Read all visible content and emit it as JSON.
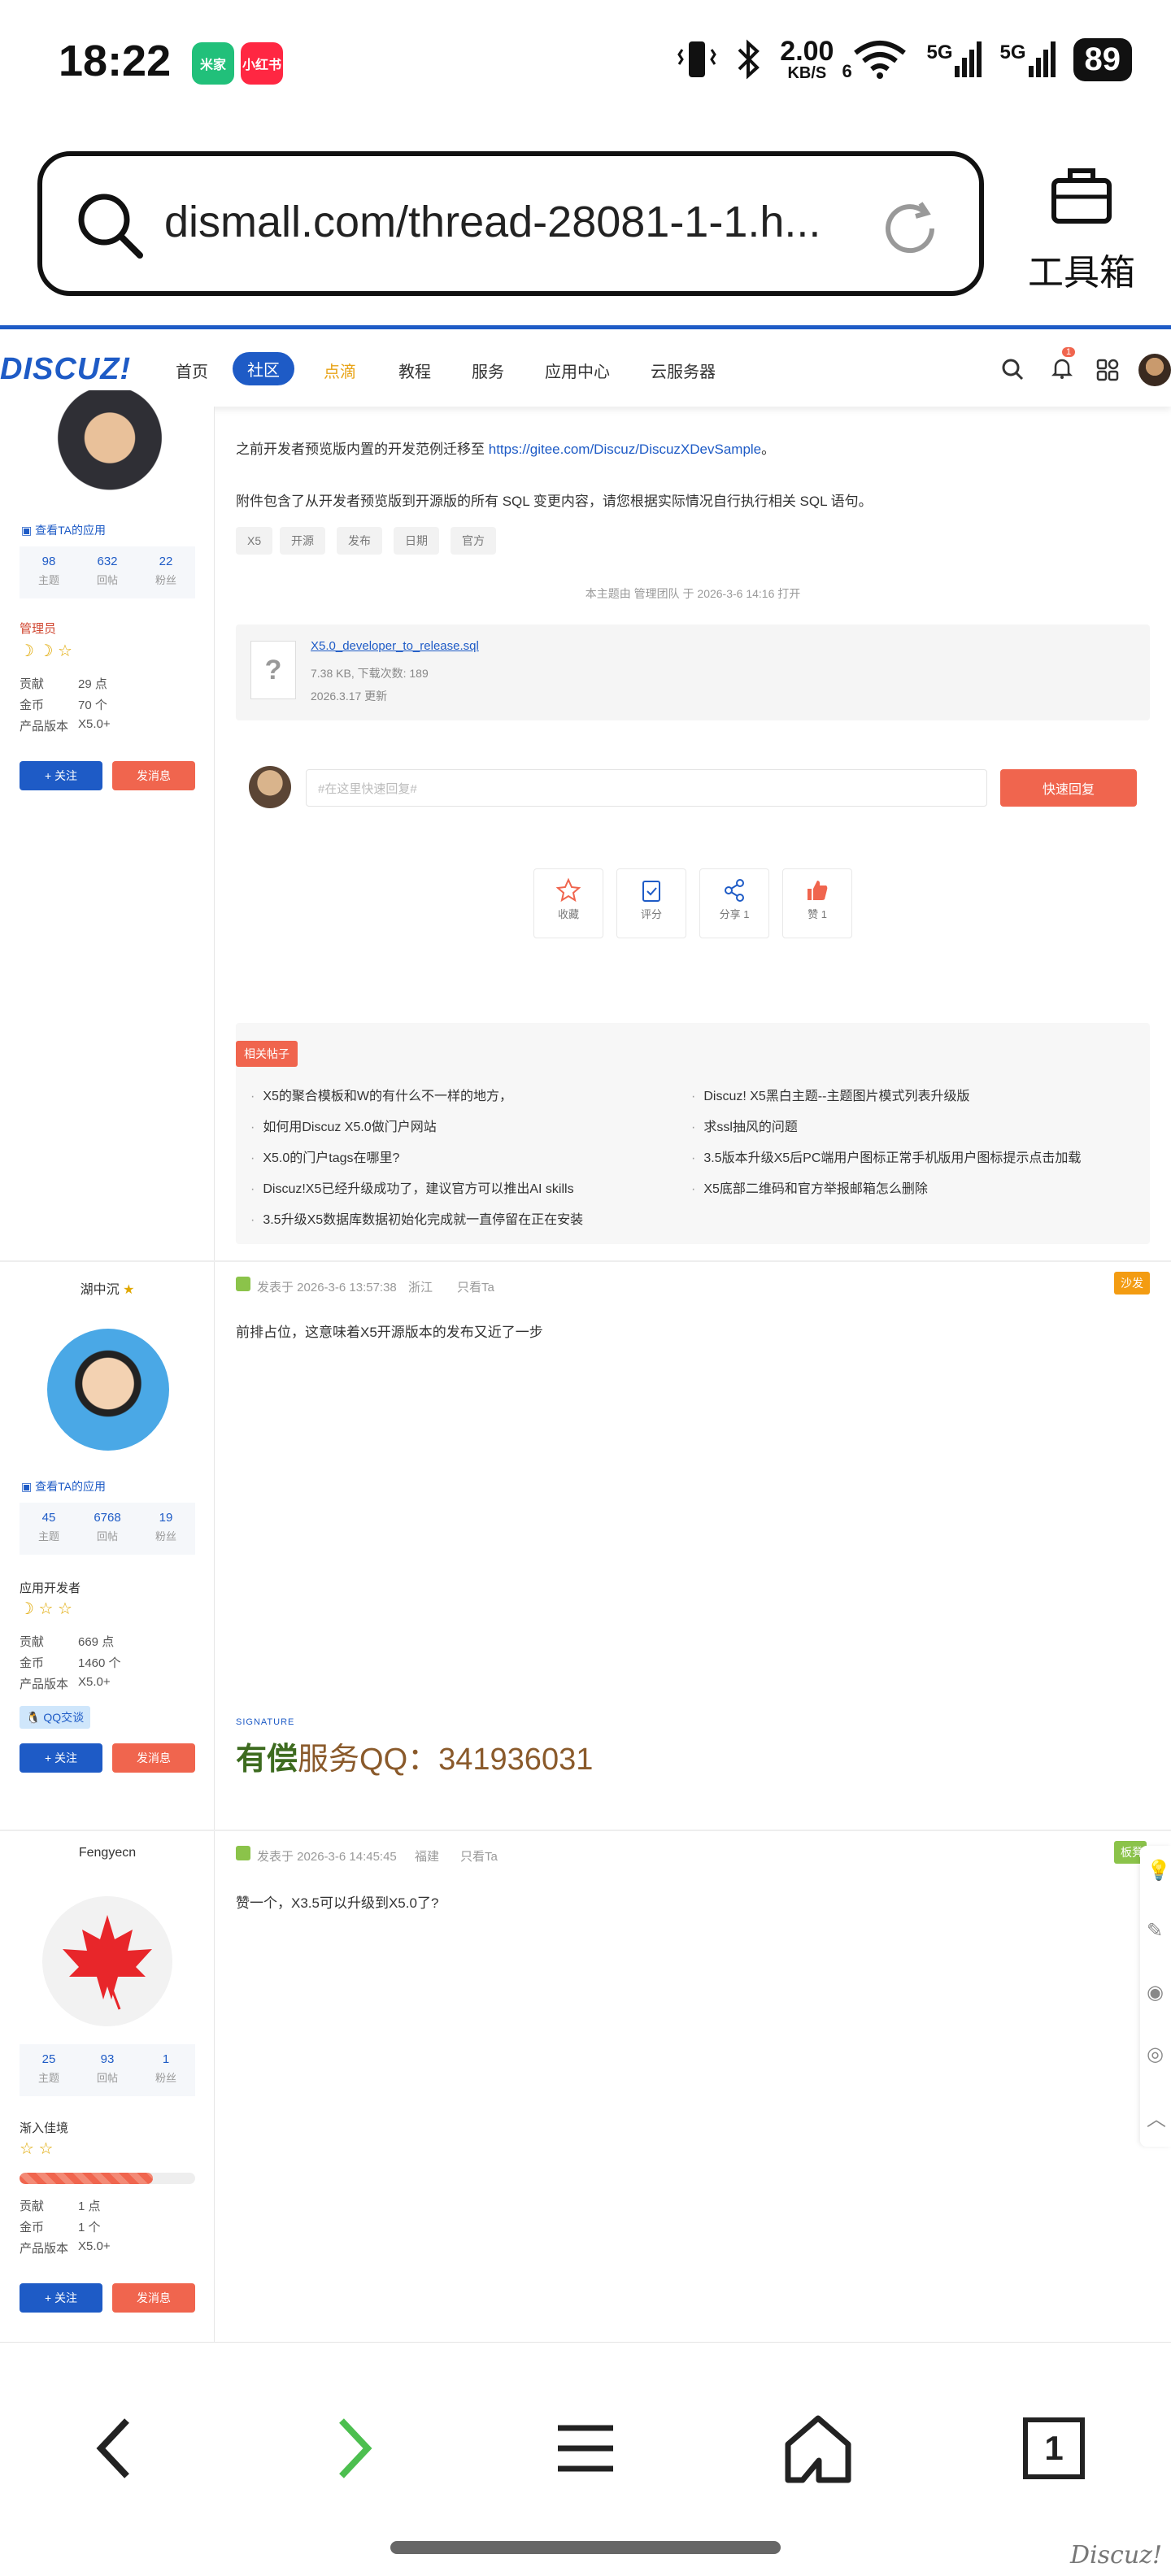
{
  "status_bar": {
    "time": "18:22",
    "apps": [
      "米家",
      "小红书"
    ],
    "network_speed_value": "2.00",
    "network_speed_unit": "KB/S",
    "wifi_label": "6",
    "signal_1": "5G",
    "signal_2": "5G",
    "battery": "89"
  },
  "browser": {
    "url": "dismall.com/thread-28081-1-1.h...",
    "toolbox_label": "工具箱"
  },
  "site_header": {
    "logo": "DISCUZ!",
    "nav": [
      "首页",
      "社区",
      "点滴",
      "教程",
      "服务",
      "应用中心",
      "云服务器"
    ],
    "active_nav": "社区",
    "notification_count": "1"
  },
  "post1": {
    "text_prefix": "之前开发者预览版内置的开发范例迁移至 ",
    "link": "https://gitee.com/Discuz/DiscuzXDevSample",
    "text_suffix": "。",
    "text2": "附件包含了从开发者预览版到开源版的所有 SQL 变更内容，请您根据实际情况自行执行相关 SQL 语句。",
    "tags": [
      "X5",
      "开源",
      "发布",
      "日期",
      "官方"
    ],
    "mod_note": "本主题由 管理团队 于 2026-3-6 14:16 打开",
    "attachment": {
      "filename": "X5.0_developer_to_release.sql",
      "size": "7.38 KB, 下载次数: 189",
      "date": "2026.3.17 更新"
    },
    "reply_placeholder": "#在这里快速回复#",
    "reply_button": "快速回复",
    "actions": [
      {
        "icon": "star-icon",
        "label": "收藏"
      },
      {
        "icon": "clipboard-check-icon",
        "label": "评分"
      },
      {
        "icon": "share-icon",
        "label": "分享 1"
      },
      {
        "icon": "thumbs-up-icon",
        "label": "赞 1"
      }
    ],
    "related_label": "相关帖子",
    "related_left": [
      "X5的聚合模板和W的有什么不一样的地方，",
      "如何用Discuz X5.0做门户网站",
      "X5.0的门户tags在哪里?",
      "Discuz!X5已经升级成功了，建议官方可以推出AI skills",
      "3.5升级X5数据库数据初始化完成就一直停留在正在安装"
    ],
    "related_right": [
      "Discuz! X5黑白主题--主题图片模式列表升级版",
      "求ssl抽风的问题",
      "3.5版本升级X5后PC端用户图标正常手机版用户图标提示点击加载",
      "X5底部二维码和官方举报邮箱怎么删除"
    ],
    "author": {
      "view_apps": "查看TA的应用",
      "stats": [
        {
          "value": "98",
          "label": "主题"
        },
        {
          "value": "632",
          "label": "回帖"
        },
        {
          "value": "22",
          "label": "粉丝"
        }
      ],
      "group": "管理员",
      "rows": [
        {
          "k": "贡献",
          "v": "29 点"
        },
        {
          "k": "金币",
          "v": "70 个"
        },
        {
          "k": "产品版本",
          "v": "X5.0+"
        }
      ],
      "follow": "+ 关注",
      "message": "发消息"
    }
  },
  "post2": {
    "author_name": "湖中沉",
    "meta": [
      "发表于 2026-3-6 13:57:38",
      "浙江",
      "只看Ta"
    ],
    "badge": "沙发",
    "content": "前排占位，这意味着X5开源版本的发布又近了一步",
    "signature_label": "SIGNATURE",
    "signature_bold": "有偿",
    "signature_text": "服务QQ：",
    "signature_num": "341936031",
    "author": {
      "view_apps": "查看TA的应用",
      "stats": [
        {
          "value": "45",
          "label": "主题"
        },
        {
          "value": "6768",
          "label": "回帖"
        },
        {
          "value": "19",
          "label": "粉丝"
        }
      ],
      "group": "应用开发者",
      "rows": [
        {
          "k": "贡献",
          "v": "669 点"
        },
        {
          "k": "金币",
          "v": "1460 个"
        },
        {
          "k": "产品版本",
          "v": "X5.0+"
        }
      ],
      "qq_badge": "QQ交谈",
      "follow": "+ 关注",
      "message": "发消息"
    }
  },
  "post3": {
    "author_name": "Fengyecn",
    "meta": [
      "发表于 2026-3-6 14:45:45",
      "福建",
      "只看Ta"
    ],
    "badge": "板凳",
    "content": "赞一个，X3.5可以升级到X5.0了?",
    "author": {
      "stats": [
        {
          "value": "25",
          "label": "主题"
        },
        {
          "value": "93",
          "label": "回帖"
        },
        {
          "value": "1",
          "label": "粉丝"
        }
      ],
      "group": "渐入佳境",
      "rows": [
        {
          "k": "贡献",
          "v": "1 点"
        },
        {
          "k": "金币",
          "v": "1 个"
        },
        {
          "k": "产品版本",
          "v": "X5.0+"
        }
      ],
      "follow": "+ 关注",
      "message": "发消息"
    }
  },
  "bottom_nav": {
    "tabs_count": "1"
  },
  "watermark": "Discuz!"
}
